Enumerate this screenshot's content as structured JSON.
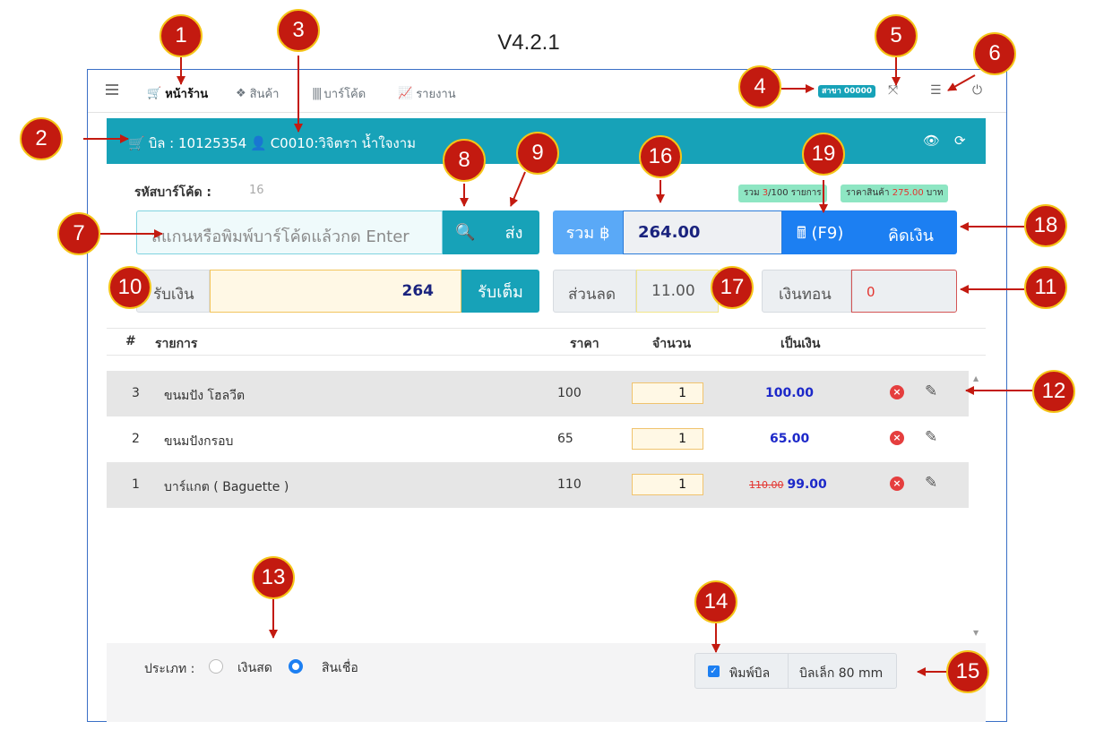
{
  "version": "V4.2.1",
  "nav": {
    "items": [
      "หน้าร้าน",
      "สินค้า",
      "บาร์โค้ด",
      "รายงาน"
    ],
    "branch": "สาขา 00000"
  },
  "bill": {
    "bill_label": "บิล : 10125354",
    "customer": "C0010:วิจิตรา น้ำใจงาม"
  },
  "barcode": {
    "label": "รหัสบาร์โค้ด :",
    "count": "16",
    "placeholder": "สแกนหรือพิมพ์บาร์โค้ดแล้วกด Enter",
    "send": "ส่ง"
  },
  "summary": {
    "items_prefix": "รวม ",
    "items_count": "3",
    "items_suffix": "/100 รายการ",
    "price_prefix": "ราคาสินค้า ",
    "price_value": "275.00",
    "price_suffix": " บาท",
    "total_label": "รวม ฿",
    "total_value": "264.00",
    "calc_key": "(F9)",
    "calc_label": "คิดเงิน"
  },
  "payment": {
    "receive_label": "รับเงิน",
    "receive_value": "264",
    "receive_full": "รับเต็ม",
    "discount_label": "ส่วนลด",
    "discount_value": "11.00",
    "change_label": "เงินทอน",
    "change_value": "0"
  },
  "table": {
    "headers": {
      "no": "#",
      "item": "รายการ",
      "price": "ราคา",
      "qty": "จำนวน",
      "amount": "เป็นเงิน"
    },
    "rows": [
      {
        "no": "3",
        "name": "ขนมปัง โฮลวีต",
        "price": "100",
        "qty": "1",
        "amount": "100.00",
        "old_amount": ""
      },
      {
        "no": "2",
        "name": "ขนมปังกรอบ",
        "price": "65",
        "qty": "1",
        "amount": "65.00",
        "old_amount": ""
      },
      {
        "no": "1",
        "name": "บาร์แกต ( Baguette )",
        "price": "110",
        "qty": "1",
        "amount": "99.00",
        "old_amount": "110.00"
      }
    ]
  },
  "footer": {
    "type_label": "ประเภท :",
    "cash": "เงินสด",
    "credit": "สินเชื่อ",
    "print_label": "พิมพ์บิล",
    "paper_size": "บิลเล็ก 80 mm"
  },
  "callouts": [
    "1",
    "2",
    "3",
    "4",
    "5",
    "6",
    "7",
    "8",
    "9",
    "10",
    "11",
    "12",
    "13",
    "14",
    "15",
    "16",
    "17",
    "18",
    "19"
  ],
  "colors": {
    "teal": "#17a2b8",
    "blue": "#1c7ff2",
    "callout": "#c31a10",
    "callout_border": "#f5c518"
  }
}
